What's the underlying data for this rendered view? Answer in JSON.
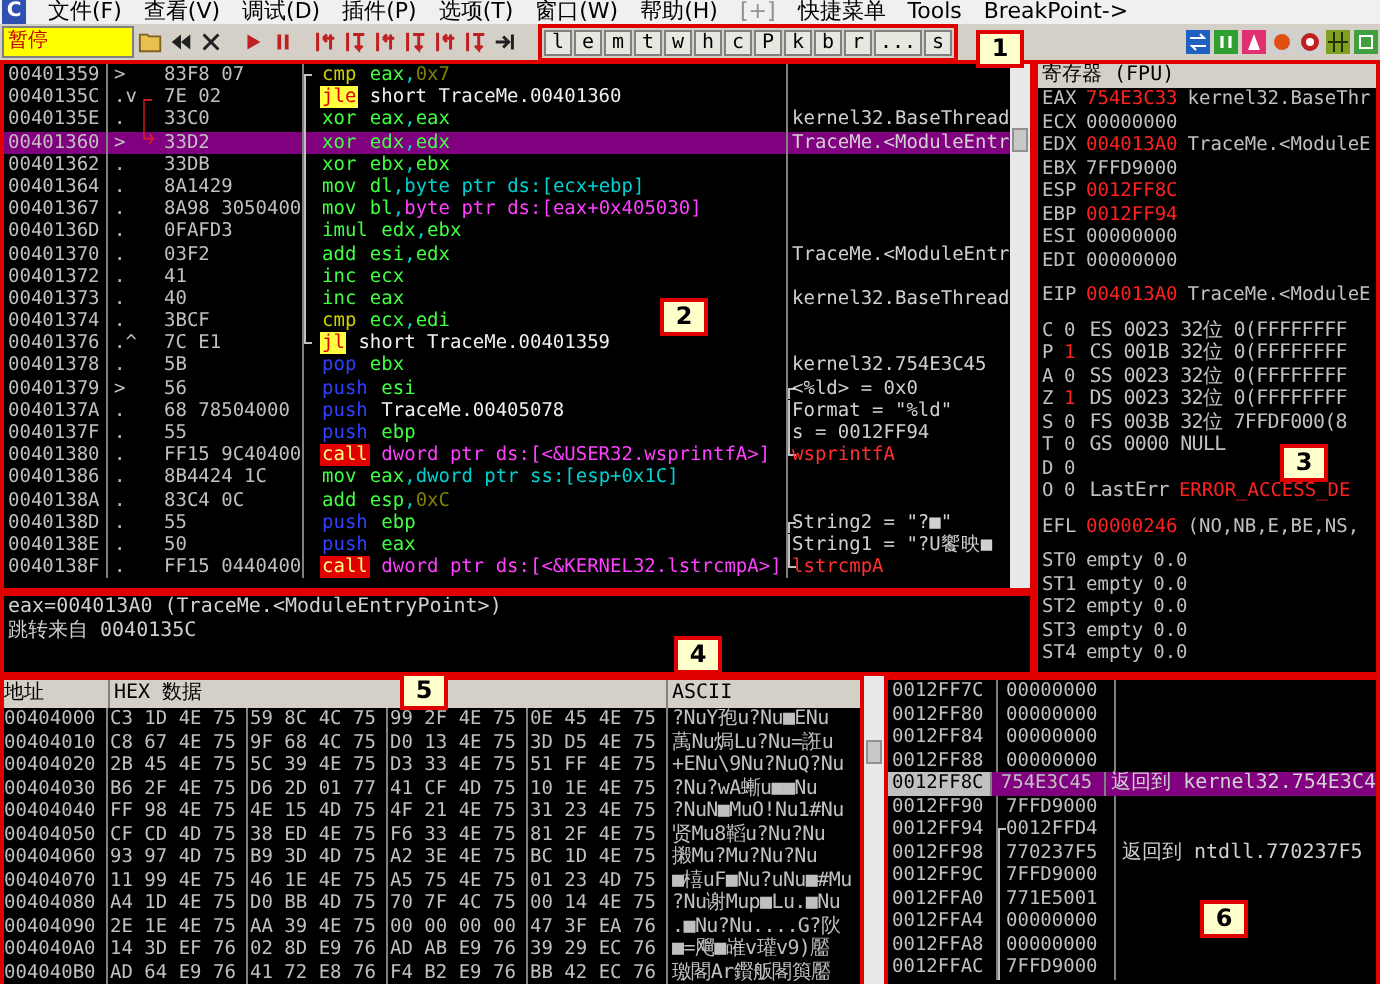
{
  "menu": {
    "logo": "C",
    "items": [
      {
        "label": "文件(F)",
        "disabled": false
      },
      {
        "label": "查看(V)",
        "disabled": false
      },
      {
        "label": "调试(D)",
        "disabled": false
      },
      {
        "label": "插件(P)",
        "disabled": false
      },
      {
        "label": "选项(T)",
        "disabled": false
      },
      {
        "label": "窗口(W)",
        "disabled": false
      },
      {
        "label": "帮助(H)",
        "disabled": false
      },
      {
        "label": "[+]",
        "disabled": true
      },
      {
        "label": "快捷菜单",
        "disabled": false
      },
      {
        "label": "Tools",
        "disabled": false
      },
      {
        "label": "BreakPoint->",
        "disabled": false
      }
    ]
  },
  "toolbar": {
    "status": "暂停",
    "letter_buttons": [
      "l",
      "e",
      "m",
      "t",
      "w",
      "h",
      "c",
      "P",
      "k",
      "b",
      "r",
      "...",
      "s"
    ]
  },
  "disassembly": {
    "rows": [
      {
        "address": "00401359",
        "mark": ">",
        "hex": "83F8 07",
        "op": "cmp",
        "kind": "cmp",
        "args": [
          {
            "text": "eax",
            "kind": "reg"
          },
          {
            "text": ",",
            "kind": "sep"
          },
          {
            "text": "0x7",
            "kind": "num"
          }
        ],
        "loop": {
          "kind": "top"
        },
        "selected": false
      },
      {
        "address": "0040135C",
        "mark": ".v",
        "hex": "7E 02",
        "op": "jle",
        "kind": "jump",
        "args": [
          {
            "text": "short TraceMe.00401360",
            "kind": "label"
          }
        ],
        "loop": {
          "kind": "mid"
        },
        "selected": false
      },
      {
        "address": "0040135E",
        "mark": ".",
        "hex": "33C0",
        "op": "xor",
        "kind": "arith",
        "args": [
          {
            "text": "eax",
            "kind": "reg"
          },
          {
            "text": ",",
            "kind": "sep"
          },
          {
            "text": "eax",
            "kind": "reg"
          }
        ],
        "loop": {
          "kind": "mid"
        },
        "comment": {
          "text": "kernel32.BaseThread",
          "kind": "plain"
        },
        "selected": false
      },
      {
        "address": "00401360",
        "mark": ">",
        "hex": "33D2",
        "op": "xor",
        "kind": "arith",
        "args": [
          {
            "text": "edx",
            "kind": "reg"
          },
          {
            "text": ",",
            "kind": "sep"
          },
          {
            "text": "edx",
            "kind": "reg"
          }
        ],
        "loop": {
          "kind": "mid"
        },
        "comment": {
          "text": "TraceMe.<ModuleEntr",
          "kind": "plain"
        },
        "selected": true
      },
      {
        "address": "00401362",
        "mark": ".",
        "hex": "33DB",
        "op": "xor",
        "kind": "arith",
        "args": [
          {
            "text": "ebx",
            "kind": "reg"
          },
          {
            "text": ",",
            "kind": "sep"
          },
          {
            "text": "ebx",
            "kind": "reg"
          }
        ],
        "loop": {
          "kind": "mid"
        },
        "selected": false
      },
      {
        "address": "00401364",
        "mark": ".",
        "hex": "8A1429",
        "op": "mov",
        "kind": "arith",
        "args": [
          {
            "text": "dl",
            "kind": "reg"
          },
          {
            "text": ",",
            "kind": "sep"
          },
          {
            "text": "byte ptr ds:[ecx+ebp]",
            "kind": "mem"
          }
        ],
        "loop": {
          "kind": "mid"
        },
        "selected": false
      },
      {
        "address": "00401367",
        "mark": ".",
        "hex": "8A98 3050400",
        "op": "mov",
        "kind": "arith",
        "args": [
          {
            "text": "bl",
            "kind": "reg"
          },
          {
            "text": ",",
            "kind": "sep"
          },
          {
            "text": "byte ptr ds:[eax+0x405030]",
            "kind": "ptr"
          }
        ],
        "loop": {
          "kind": "mid"
        },
        "selected": false
      },
      {
        "address": "0040136D",
        "mark": ".",
        "hex": "0FAFD3",
        "op": "imul",
        "kind": "arith",
        "args": [
          {
            "text": "edx",
            "kind": "reg"
          },
          {
            "text": ",",
            "kind": "sep"
          },
          {
            "text": "ebx",
            "kind": "reg"
          }
        ],
        "loop": {
          "kind": "mid"
        },
        "selected": false
      },
      {
        "address": "00401370",
        "mark": ".",
        "hex": "03F2",
        "op": "add",
        "kind": "arith",
        "args": [
          {
            "text": "esi",
            "kind": "reg"
          },
          {
            "text": ",",
            "kind": "sep"
          },
          {
            "text": "edx",
            "kind": "reg"
          }
        ],
        "loop": {
          "kind": "mid"
        },
        "comment": {
          "text": "TraceMe.<ModuleEntr",
          "kind": "plain"
        },
        "selected": false
      },
      {
        "address": "00401372",
        "mark": ".",
        "hex": "41",
        "op": "inc",
        "kind": "arith",
        "args": [
          {
            "text": "ecx",
            "kind": "reg"
          }
        ],
        "loop": {
          "kind": "mid"
        },
        "selected": false
      },
      {
        "address": "00401373",
        "mark": ".",
        "hex": "40",
        "op": "inc",
        "kind": "arith",
        "args": [
          {
            "text": "eax",
            "kind": "reg"
          }
        ],
        "loop": {
          "kind": "mid"
        },
        "comment": {
          "text": "kernel32.BaseThread",
          "kind": "plain"
        },
        "selected": false
      },
      {
        "address": "00401374",
        "mark": ".",
        "hex": "3BCF",
        "op": "cmp",
        "kind": "cmp",
        "args": [
          {
            "text": "ecx",
            "kind": "reg"
          },
          {
            "text": ",",
            "kind": "sep"
          },
          {
            "text": "edi",
            "kind": "reg"
          }
        ],
        "loop": {
          "kind": "mid"
        },
        "selected": false
      },
      {
        "address": "00401376",
        "mark": ".^",
        "hex": "7C E1",
        "op": "jl",
        "kind": "jump",
        "args": [
          {
            "text": "short TraceMe.00401359",
            "kind": "label"
          }
        ],
        "loop": {
          "kind": "bottom"
        },
        "selected": false
      },
      {
        "address": "00401378",
        "mark": ".",
        "hex": "5B",
        "op": "pop",
        "kind": "stack",
        "args": [
          {
            "text": "ebx",
            "kind": "reg"
          }
        ],
        "comment": {
          "text": "kernel32.754E3C45",
          "kind": "plain"
        },
        "selected": false
      },
      {
        "address": "00401379",
        "mark": ">",
        "hex": "56",
        "op": "push",
        "kind": "stack",
        "args": [
          {
            "text": "esi",
            "kind": "reg"
          }
        ],
        "comment": {
          "text": "<%ld> = 0x0",
          "kind": "plain",
          "group": {
            "kind": "top"
          }
        },
        "selected": false
      },
      {
        "address": "0040137A",
        "mark": ".",
        "hex": "68 78504000",
        "op": "push",
        "kind": "stack",
        "args": [
          {
            "text": "TraceMe.00405078",
            "kind": "label"
          }
        ],
        "comment": {
          "text": "Format = \"%ld\"",
          "kind": "plain",
          "group": {
            "kind": "mid"
          }
        },
        "selected": false
      },
      {
        "address": "0040137F",
        "mark": ".",
        "hex": "55",
        "op": "push",
        "kind": "stack",
        "args": [
          {
            "text": "ebp",
            "kind": "reg"
          }
        ],
        "comment": {
          "text": "s = 0012FF94",
          "kind": "plain",
          "group": {
            "kind": "mid"
          }
        },
        "selected": false
      },
      {
        "address": "00401380",
        "mark": ".",
        "hex": "FF15 9C40400",
        "op": "call",
        "kind": "call",
        "args": [
          {
            "text": "dword ptr ds:[<&USER32.wsprintfA>]",
            "kind": "ptr"
          }
        ],
        "comment": {
          "text": "wsprintfA",
          "kind": "api",
          "group": {
            "kind": "bottom"
          }
        },
        "selected": false
      },
      {
        "address": "00401386",
        "mark": ".",
        "hex": "8B4424 1C",
        "op": "mov",
        "kind": "arith",
        "args": [
          {
            "text": "eax",
            "kind": "reg"
          },
          {
            "text": ",",
            "kind": "sep"
          },
          {
            "text": "dword ptr ss:[esp+0x1C]",
            "kind": "mem"
          }
        ],
        "selected": false
      },
      {
        "address": "0040138A",
        "mark": ".",
        "hex": "83C4 0C",
        "op": "add",
        "kind": "arith",
        "args": [
          {
            "text": "esp",
            "kind": "reg"
          },
          {
            "text": ",",
            "kind": "sep"
          },
          {
            "text": "0xC",
            "kind": "num"
          }
        ],
        "selected": false
      },
      {
        "address": "0040138D",
        "mark": ".",
        "hex": "55",
        "op": "push",
        "kind": "stack",
        "args": [
          {
            "text": "ebp",
            "kind": "reg"
          }
        ],
        "comment": {
          "text": "String2 = \"?■\"",
          "kind": "plain",
          "group": {
            "kind": "top"
          }
        },
        "selected": false
      },
      {
        "address": "0040138E",
        "mark": ".",
        "hex": "50",
        "op": "push",
        "kind": "stack",
        "args": [
          {
            "text": "eax",
            "kind": "reg"
          }
        ],
        "comment": {
          "text": "String1 = \"?U饗映■",
          "kind": "plain",
          "group": {
            "kind": "mid"
          }
        },
        "selected": false
      },
      {
        "address": "0040138F",
        "mark": ".",
        "hex": "FF15 0440400",
        "op": "call",
        "kind": "call",
        "args": [
          {
            "text": "dword ptr ds:[<&KERNEL32.lstrcmpA>]",
            "kind": "ptr"
          }
        ],
        "comment": {
          "text": "lstrcmpA",
          "kind": "api",
          "group": {
            "kind": "bottom"
          }
        },
        "selected": false
      }
    ]
  },
  "info": {
    "lines": [
      "eax=004013A0 (TraceMe.<ModuleEntryPoint>)",
      "跳转来自 0040135C"
    ]
  },
  "registers": {
    "title": "寄存器 (FPU)",
    "rows": [
      {
        "kind": "reg",
        "name": "EAX",
        "value": "754E3C33",
        "changed": true,
        "note": "kernel32.BaseThr"
      },
      {
        "kind": "reg",
        "name": "ECX",
        "value": "00000000",
        "changed": false
      },
      {
        "kind": "reg",
        "name": "EDX",
        "value": "004013A0",
        "changed": true,
        "note": "TraceMe.<ModuleE"
      },
      {
        "kind": "reg",
        "name": "EBX",
        "value": "7FFD9000",
        "changed": false
      },
      {
        "kind": "reg",
        "name": "ESP",
        "value": "0012FF8C",
        "changed": true
      },
      {
        "kind": "reg",
        "name": "EBP",
        "value": "0012FF94",
        "changed": true
      },
      {
        "kind": "reg",
        "name": "ESI",
        "value": "00000000",
        "changed": false
      },
      {
        "kind": "reg",
        "name": "EDI",
        "value": "00000000",
        "changed": false
      },
      {
        "kind": "gap"
      },
      {
        "kind": "reg",
        "name": "EIP",
        "value": "004013A0",
        "changed": true,
        "note": "TraceMe.<ModuleE"
      },
      {
        "kind": "gap"
      },
      {
        "kind": "flag",
        "name": "C",
        "value": "0",
        "changed": false,
        "note": "ES 0023 32位 0(FFFFFFFF"
      },
      {
        "kind": "flag",
        "name": "P",
        "value": "1",
        "changed": true,
        "note": "CS 001B 32位 0(FFFFFFFF"
      },
      {
        "kind": "flag",
        "name": "A",
        "value": "0",
        "changed": false,
        "note": "SS 0023 32位 0(FFFFFFFF"
      },
      {
        "kind": "flag",
        "name": "Z",
        "value": "1",
        "changed": true,
        "note": "DS 0023 32位 0(FFFFFFFF"
      },
      {
        "kind": "flag",
        "name": "S",
        "value": "0",
        "changed": false,
        "note": "FS 003B 32位 7FFDF000(8"
      },
      {
        "kind": "flag",
        "name": "T",
        "value": "0",
        "changed": false,
        "note": "GS 0000 NULL"
      },
      {
        "kind": "flag",
        "name": "D",
        "value": "0",
        "changed": false
      },
      {
        "kind": "flag",
        "name": "O",
        "value": "0",
        "changed": false,
        "note": "LastErr",
        "detail": "ERROR_ACCESS_DE",
        "alert": true
      },
      {
        "kind": "gap"
      },
      {
        "kind": "reg",
        "name": "EFL",
        "value": "00000246",
        "changed": true,
        "note": "(NO,NB,E,BE,NS,"
      },
      {
        "kind": "gap"
      },
      {
        "kind": "reg",
        "name": "ST0",
        "value": "empty",
        "changed": false,
        "note": "0.0"
      },
      {
        "kind": "reg",
        "name": "ST1",
        "value": "empty",
        "changed": false,
        "note": "0.0"
      },
      {
        "kind": "reg",
        "name": "ST2",
        "value": "empty",
        "changed": false,
        "note": "0.0"
      },
      {
        "kind": "reg",
        "name": "ST3",
        "value": "empty",
        "changed": false,
        "note": "0.0"
      },
      {
        "kind": "reg",
        "name": "ST4",
        "value": "empty",
        "changed": false,
        "note": "0.0"
      }
    ]
  },
  "dump": {
    "columns": [
      "地址",
      "HEX 数据",
      "ASCII"
    ],
    "rows": [
      {
        "address": "00404000",
        "hex": [
          "C3 1D 4E 75",
          "59 8C 4C 75",
          "99 2F 4E 75",
          "0E 45 4E 75"
        ],
        "ascii": "?NuY孢u?Nu■ENu"
      },
      {
        "address": "00404010",
        "hex": [
          "C8 67 4E 75",
          "9F 68 4C 75",
          "D0 13 4E 75",
          "3D D5 4E 75"
        ],
        "ascii": "萭Nu焗Lu?Nu=誑u"
      },
      {
        "address": "00404020",
        "hex": [
          "2B 45 4E 75",
          "5C 39 4E 75",
          "D3 33 4E 75",
          "51 FF 4E 75"
        ],
        "ascii": "+ENu\\9Nu?NuQ?Nu"
      },
      {
        "address": "00404030",
        "hex": [
          "B6 2F 4E 75",
          "D6 2D 01 77",
          "41 CF 4D 75",
          "10 1E 4E 75"
        ],
        "ascii": "?Nu?wA螹u■■Nu"
      },
      {
        "address": "00404040",
        "hex": [
          "FF 98 4E 75",
          "4E 15 4D 75",
          "4F 21 4E 75",
          "31 23 4E 75"
        ],
        "ascii": "?NuN■MuO!Nu1#Nu"
      },
      {
        "address": "00404050",
        "hex": [
          "CF CD 4D 75",
          "38 ED 4E 75",
          "F6 33 4E 75",
          "81 2F 4E 75"
        ],
        "ascii": "贤Mu8鞱u?Nu?Nu"
      },
      {
        "address": "00404060",
        "hex": [
          "93 97 4D 75",
          "B9 3D 4D 75",
          "A2 3E 4E 75",
          "BC 1D 4E 75"
        ],
        "ascii": "摋Mu?Mu?Nu?Nu"
      },
      {
        "address": "00404070",
        "hex": [
          "11 99 4E 75",
          "46 1E 4E 75",
          "A5 75 4E 75",
          "01 23 4D 75"
        ],
        "ascii": "■橲uF■Nu?uNu■#Mu"
      },
      {
        "address": "00404080",
        "hex": [
          "A4 1D 4E 75",
          "D0 BB 4D 75",
          "70 7F 4C 75",
          "00 14 4E 75"
        ],
        "ascii": "?Nu谢Mup■Lu.■Nu"
      },
      {
        "address": "00404090",
        "hex": [
          "2E 1E 4E 75",
          "AA 39 4E 75",
          "00 00 00 00",
          "47 3F EA 76"
        ],
        "ascii": ".■Nu?Nu....G?阦"
      },
      {
        "address": "004040A0",
        "hex": [
          "14 3D EF 76",
          "02 8D E9 76",
          "AD AB E9 76",
          "39 29 EC 76"
        ],
        "ascii": "■=飗■嶉v瓘v9)靨"
      },
      {
        "address": "004040B0",
        "hex": [
          "AD 64 E9 76",
          "41 72 E8 76",
          "F4 B2 E9 76",
          "BB 42 EC 76"
        ],
        "ascii": "璬閣Ar鑦舨閣籅靨"
      }
    ]
  },
  "stack": {
    "rows": [
      {
        "address": "0012FF7C",
        "value": "00000000",
        "selected": false
      },
      {
        "address": "0012FF80",
        "value": "00000000",
        "selected": false
      },
      {
        "address": "0012FF84",
        "value": "00000000",
        "selected": false
      },
      {
        "address": "0012FF88",
        "value": "00000000",
        "selected": false
      },
      {
        "address": "0012FF8C",
        "value": "754E3C45",
        "comment": "返回到 kernel32.754E3C4",
        "selected": true
      },
      {
        "address": "0012FF90",
        "value": "7FFD9000",
        "selected": false
      },
      {
        "address": "0012FF94",
        "value": "0012FFD4",
        "link": {
          "kind": "top"
        },
        "selected": false
      },
      {
        "address": "0012FF98",
        "value": "770237F5",
        "comment": "返回到 ntdll.770237F5",
        "link": {
          "kind": "mid"
        },
        "selected": false
      },
      {
        "address": "0012FF9C",
        "value": "7FFD9000",
        "link": {
          "kind": "mid"
        },
        "selected": false
      },
      {
        "address": "0012FFA0",
        "value": "771E5001",
        "link": {
          "kind": "mid"
        },
        "selected": false
      },
      {
        "address": "0012FFA4",
        "value": "00000000",
        "link": {
          "kind": "mid"
        },
        "selected": false
      },
      {
        "address": "0012FFA8",
        "value": "00000000",
        "link": {
          "kind": "mid"
        },
        "selected": false
      },
      {
        "address": "0012FFAC",
        "value": "7FFD9000",
        "link": {
          "kind": "mid"
        },
        "selected": false
      }
    ]
  },
  "annotations": [
    {
      "label": "1"
    },
    {
      "label": "2"
    },
    {
      "label": "3"
    },
    {
      "label": "4"
    },
    {
      "label": "5"
    },
    {
      "label": "6"
    }
  ]
}
